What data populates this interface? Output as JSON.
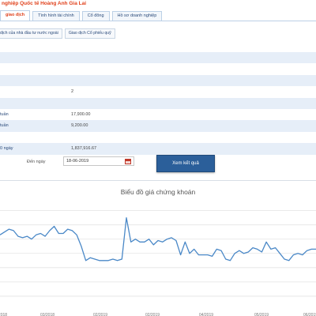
{
  "company": {
    "title": "nghiệp Quốc tế Hoàng Anh Gia Lai"
  },
  "tabs_main": [
    {
      "label": "giao dịch",
      "active": true
    },
    {
      "label": "Tình hình tài chính",
      "active": false
    },
    {
      "label": "Cổ đông",
      "active": false
    },
    {
      "label": "Hồ sơ doanh nghiệp",
      "active": false
    }
  ],
  "tabs_sub": [
    {
      "label": "dịch của nhà đầu tư nước ngoài"
    },
    {
      "label": "Giao dịch Cổ phiếu quỹ"
    }
  ],
  "info_rows": [
    {
      "label": "",
      "value": ""
    },
    {
      "label": "",
      "value": ""
    },
    {
      "label": "",
      "value": ""
    },
    {
      "label": "",
      "value": "2"
    },
    {
      "label": "",
      "value": ""
    },
    {
      "label": "tuần",
      "value": "17,900.00"
    },
    {
      "label": "tuần",
      "value": "9,200.00"
    },
    {
      "label": "",
      "value": ""
    },
    {
      "label": "0 ngày",
      "value": "1,837,916.67"
    }
  ],
  "date_filter": {
    "label": "Đến ngày",
    "value": "18-06-2019",
    "button_label": "Xem kết quả"
  },
  "chart_data": {
    "type": "line",
    "title": "Biểu đồ giá chứng khoán",
    "color": "#4a88c7",
    "grid": true,
    "ylim": [
      0,
      7.2
    ],
    "x_ticks": [
      "02/2018",
      "03/2018",
      "02/2019",
      "02/2019",
      "04/2019",
      "05/2019",
      "06/2019"
    ],
    "series": [
      {
        "values": [
          5.3,
          5.5,
          5.7,
          5.6,
          5.2,
          5.1,
          5.2,
          5.0,
          5.3,
          5.4,
          5.2,
          5.6,
          5.9,
          5.4,
          5.4,
          5.7,
          5.6,
          5.3,
          4.5,
          3.5,
          3.7,
          3.6,
          3.5,
          3.5,
          3.5,
          3.6,
          3.5,
          3.6,
          6.5,
          4.8,
          5.0,
          4.8,
          4.8,
          5.0,
          4.6,
          4.9,
          4.8,
          5.0,
          5.1,
          4.9,
          3.9,
          4.8,
          4.0,
          4.3,
          3.9,
          3.9,
          3.9,
          3.8,
          4.3,
          4.2,
          3.6,
          3.5,
          4.0,
          4.2,
          4.0,
          4.1,
          4.4,
          4.3,
          4.1,
          4.8,
          4.3,
          4.4,
          4.0,
          3.6,
          3.5,
          3.9,
          4.0,
          3.9,
          4.2,
          4.3,
          4.3
        ]
      }
    ]
  }
}
